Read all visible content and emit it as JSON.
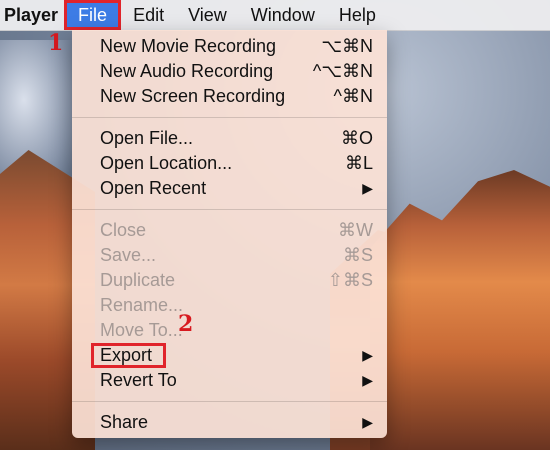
{
  "menubar": {
    "app_name": "Player",
    "items": [
      {
        "label": "File",
        "active": true
      },
      {
        "label": "Edit"
      },
      {
        "label": "View"
      },
      {
        "label": "Window"
      },
      {
        "label": "Help"
      }
    ]
  },
  "annotations": {
    "step1": "1",
    "step2": "2",
    "color": "#e0242b"
  },
  "file_menu": {
    "group1": [
      {
        "label": "New Movie Recording",
        "shortcut": "⌥⌘N"
      },
      {
        "label": "New Audio Recording",
        "shortcut": "^⌥⌘N"
      },
      {
        "label": "New Screen Recording",
        "shortcut": "^⌘N"
      }
    ],
    "group2": [
      {
        "label": "Open File...",
        "shortcut": "⌘O"
      },
      {
        "label": "Open Location...",
        "shortcut": "⌘L"
      },
      {
        "label": "Open Recent",
        "submenu": "▶"
      }
    ],
    "group3": [
      {
        "label": "Close",
        "shortcut": "⌘W",
        "disabled": true
      },
      {
        "label": "Save...",
        "shortcut": "⌘S",
        "disabled": true
      },
      {
        "label": "Duplicate",
        "shortcut": "⇧⌘S",
        "disabled": true
      },
      {
        "label": "Rename...",
        "disabled": true
      },
      {
        "label": "Move To...",
        "disabled": true
      },
      {
        "label": "Export",
        "submenu": "▶"
      },
      {
        "label": "Revert To",
        "submenu": "▶"
      }
    ],
    "group4": [
      {
        "label": "Share",
        "submenu": "▶"
      }
    ]
  },
  "colors": {
    "menubar_active": "#3d7ce5",
    "highlight_box": "#e0242b"
  }
}
